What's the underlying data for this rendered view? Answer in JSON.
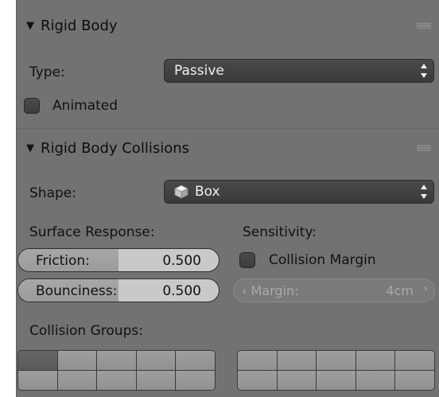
{
  "rigid_body": {
    "title": "Rigid Body",
    "type_label": "Type:",
    "type_value": "Passive",
    "animated_label": "Animated",
    "animated_checked": false
  },
  "collisions": {
    "title": "Rigid Body Collisions",
    "shape_label": "Shape:",
    "shape_value": "Box",
    "shape_icon": "cube-icon",
    "surface_response_label": "Surface Response:",
    "sensitivity_label": "Sensitivity:",
    "friction_label": "Friction:",
    "friction_value": "0.500",
    "friction_fraction": 0.5,
    "bounciness_label": "Bounciness:",
    "bounciness_value": "0.500",
    "bounciness_fraction": 0.5,
    "collision_margin_label": "Collision Margin",
    "collision_margin_checked": false,
    "margin_label": "Margin:",
    "margin_value": "4cm",
    "collision_groups_label": "Collision Groups:",
    "groups_left_active": [
      0
    ],
    "groups_right_active": []
  },
  "colors": {
    "panel": "#727272",
    "dropdown": "#3f3f3f",
    "field": "#c9c9c9"
  }
}
